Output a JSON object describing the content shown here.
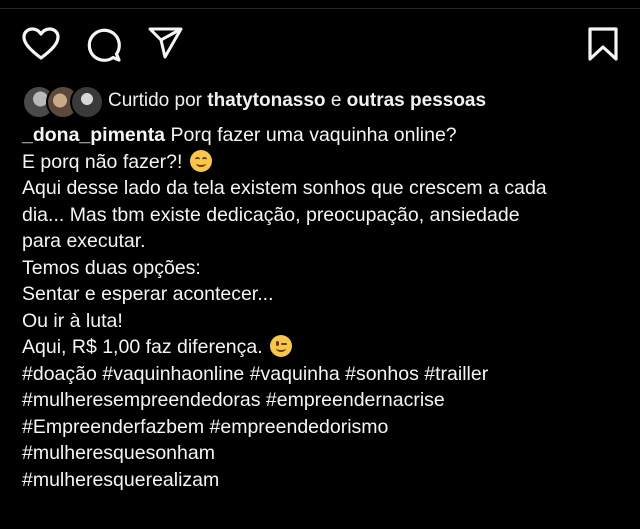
{
  "post": {
    "actions": {
      "like_icon": "heart-outline-icon",
      "comment_icon": "comment-bubble-icon",
      "share_icon": "paper-plane-icon",
      "save_icon": "bookmark-outline-icon"
    },
    "likes": {
      "prefix": "Curtido por",
      "user": "thatytonasso",
      "connector": "e",
      "others": "outras pessoas"
    },
    "caption": {
      "username": "_dona_pimenta",
      "lines": [
        "Porq fazer uma vaquinha online?",
        "E porq não fazer?!",
        "Aqui desse lado da tela existem sonhos que crescem a cada",
        "dia... Mas tbm existe dedicação, preocupação, ansiedade",
        "para executar.",
        "Temos duas opções:",
        "Sentar e esperar acontecer...",
        "Ou ir à luta!",
        "Aqui, R$ 1,00 faz diferença.",
        "#doação #vaquinhaonline #vaquinha #sonhos #trailler",
        "#mulheresempreendedoras #empreendernacrise",
        "#Empreenderfazbem #empreendedorismo",
        "#mulheresquesonham",
        "#mulheresquerealizam"
      ]
    }
  }
}
